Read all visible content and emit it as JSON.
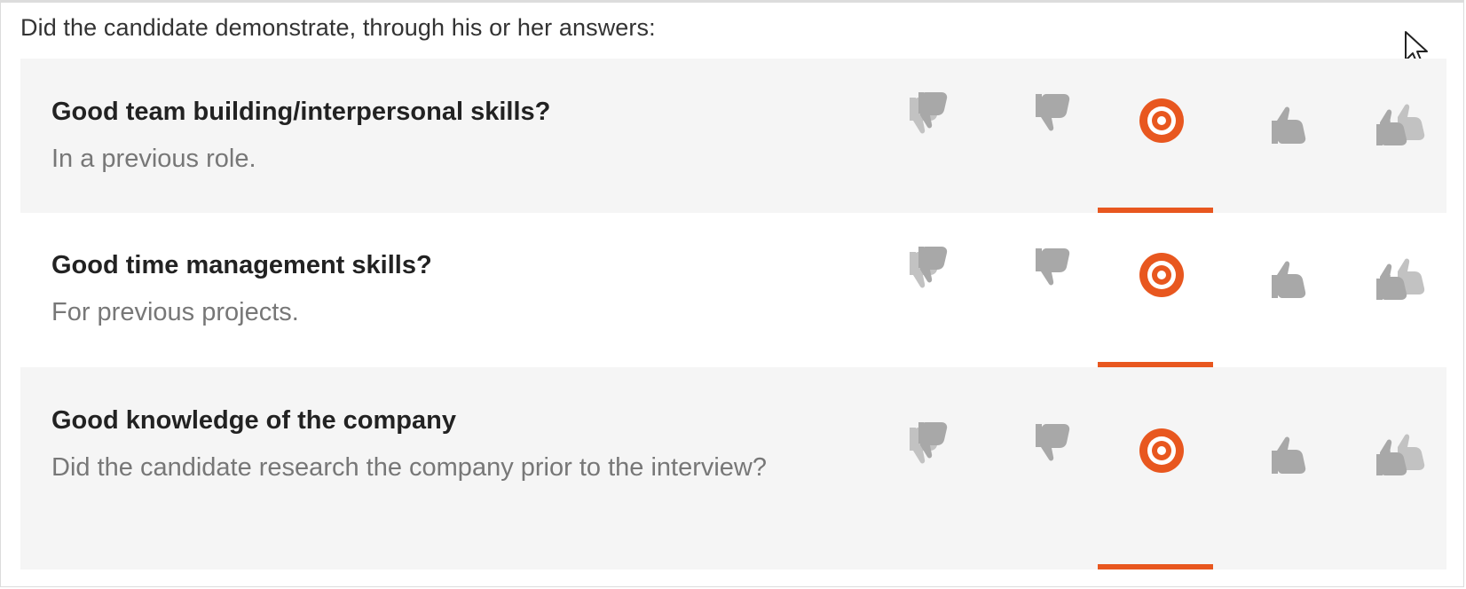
{
  "intro": "Did the candidate demonstrate, through his or her answers:",
  "colors": {
    "accent": "#e8571f",
    "icon_inactive": "#aaaaaa",
    "row_shaded": "#f5f5f5"
  },
  "rating_options": [
    {
      "name": "strong-disagree",
      "icon": "double-thumbs-down-icon"
    },
    {
      "name": "disagree",
      "icon": "thumbs-down-icon"
    },
    {
      "name": "neutral",
      "icon": "target-icon"
    },
    {
      "name": "agree",
      "icon": "thumbs-up-icon"
    },
    {
      "name": "strong-agree",
      "icon": "double-thumbs-up-icon"
    }
  ],
  "questions": [
    {
      "title": "Good team building/interpersonal skills?",
      "subtitle": "In a previous role.",
      "selected": "neutral"
    },
    {
      "title": "Good time management skills?",
      "subtitle": "For previous projects.",
      "selected": "neutral"
    },
    {
      "title": "Good knowledge of the company",
      "subtitle": "Did the candidate research the company prior to the interview?",
      "selected": "neutral"
    }
  ]
}
